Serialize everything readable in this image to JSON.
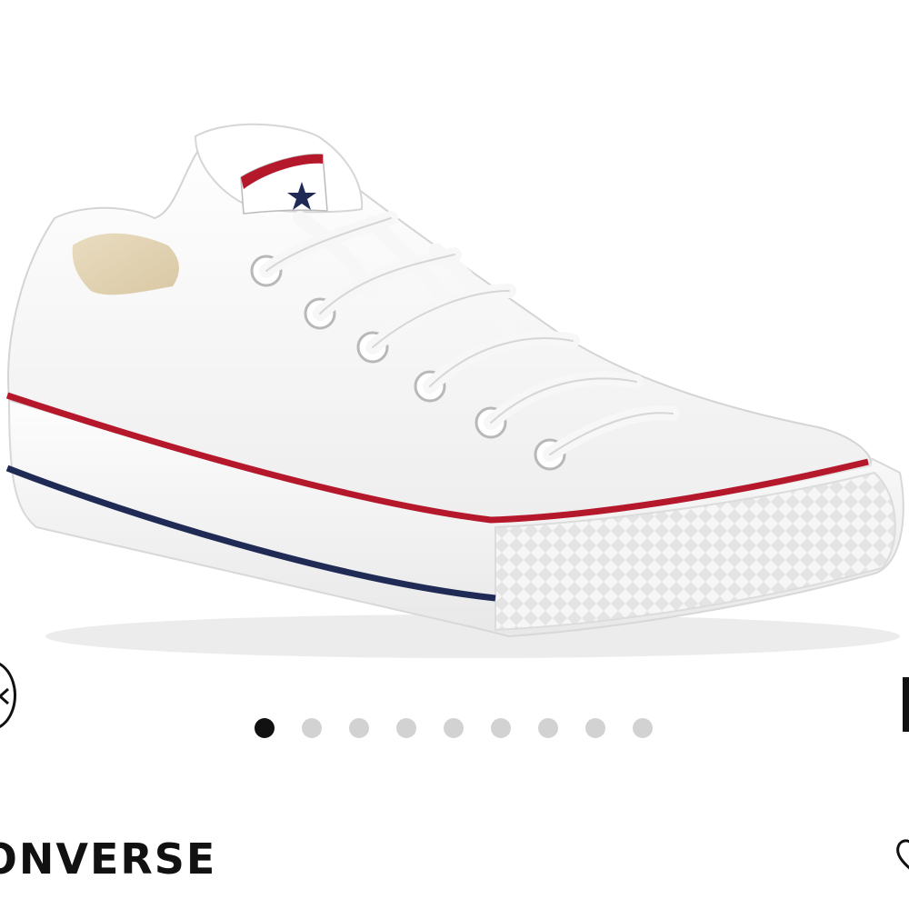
{
  "product": {
    "brand": "CONVERSE",
    "image_description_icon": "white-low-top-sneaker-image"
  },
  "carousel": {
    "total_images": 9,
    "active_index": 0,
    "prev_icon": "chevron-left-icon",
    "next_icon": "chevron-right-icon"
  },
  "actions": {
    "favorite_icon": "heart-icon"
  },
  "colors": {
    "dot_active": "#111111",
    "dot_inactive": "#d2d2d2",
    "stripe_red": "#b5172b",
    "stripe_navy": "#1f2a55"
  }
}
